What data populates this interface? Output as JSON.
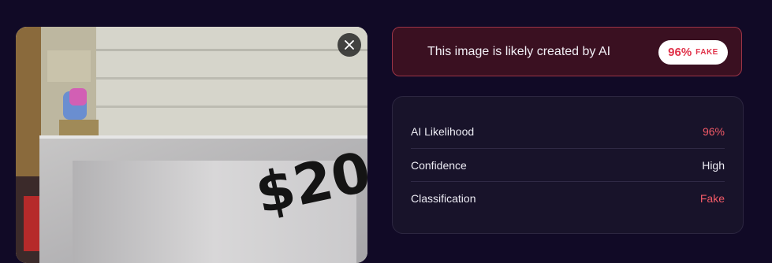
{
  "verdict": {
    "message": "This image is likely created by AI",
    "score": "96%",
    "tag": "FAKE",
    "accent_color": "#e0334a"
  },
  "photo": {
    "price_text": "$20"
  },
  "stats": {
    "rows": [
      {
        "label": "AI Likelihood",
        "value": "96%",
        "color": "#f15a67"
      },
      {
        "label": "Confidence",
        "value": "High",
        "color": "#ecebf3"
      },
      {
        "label": "Classification",
        "value": "Fake",
        "color": "#f15a67"
      }
    ]
  },
  "icons": {
    "close": "close-icon"
  }
}
